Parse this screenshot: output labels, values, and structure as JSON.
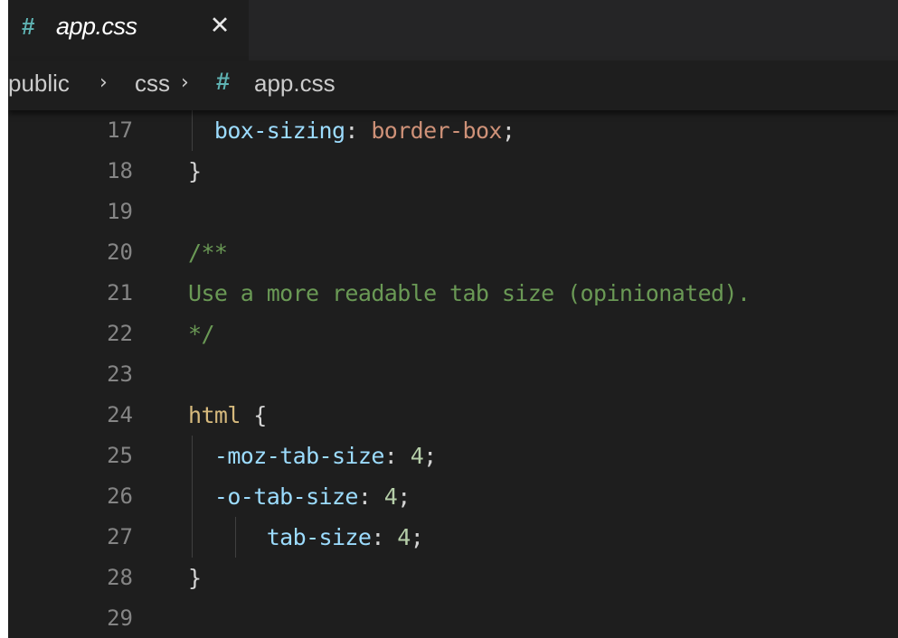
{
  "tab": {
    "icon": "hash-icon",
    "title": "app.css",
    "close_glyph": "✕"
  },
  "breadcrumb": {
    "items": [
      "public",
      "css",
      "app.css"
    ],
    "separator": "›",
    "file_icon": "#"
  },
  "editor": {
    "lines": [
      {
        "number": "17",
        "text": "  box-sizing: border-box;"
      },
      {
        "number": "18",
        "text": "}"
      },
      {
        "number": "19",
        "text": ""
      },
      {
        "number": "20",
        "text": "/**"
      },
      {
        "number": "21",
        "text": "Use a more readable tab size (opinionated)."
      },
      {
        "number": "22",
        "text": "*/"
      },
      {
        "number": "23",
        "text": ""
      },
      {
        "number": "24",
        "text": "html {"
      },
      {
        "number": "25",
        "text": "  -moz-tab-size: 4;"
      },
      {
        "number": "26",
        "text": "  -o-tab-size: 4;"
      },
      {
        "number": "27",
        "text": "      tab-size: 4;"
      },
      {
        "number": "28",
        "text": "}"
      },
      {
        "number": "29",
        "text": ""
      }
    ]
  },
  "colors": {
    "editor_bg": "#1e1e1e",
    "tabbar_bg": "#252526",
    "line_number": "#858585",
    "property": "#9cdcfe",
    "string_value": "#ce9178",
    "number": "#b5cea8",
    "selector": "#d7ba7d",
    "comment": "#6a9955",
    "css_icon": "#5fb3b3"
  }
}
